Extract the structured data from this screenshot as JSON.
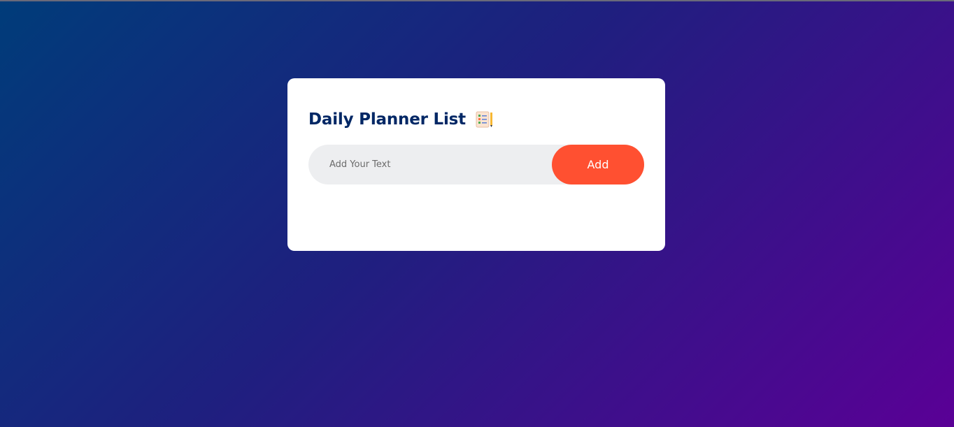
{
  "app": {
    "title": "Daily Planner List",
    "title_icon": "notepad-icon"
  },
  "input": {
    "placeholder": "Add Your Text",
    "value": ""
  },
  "button": {
    "add_label": "Add"
  },
  "tasks": [],
  "colors": {
    "background_start": "#003c7a",
    "background_end": "#5a0096",
    "card": "#ffffff",
    "title": "#002765",
    "input_bg": "#edeef0",
    "button": "#ff5031",
    "button_text": "#ffffff"
  }
}
